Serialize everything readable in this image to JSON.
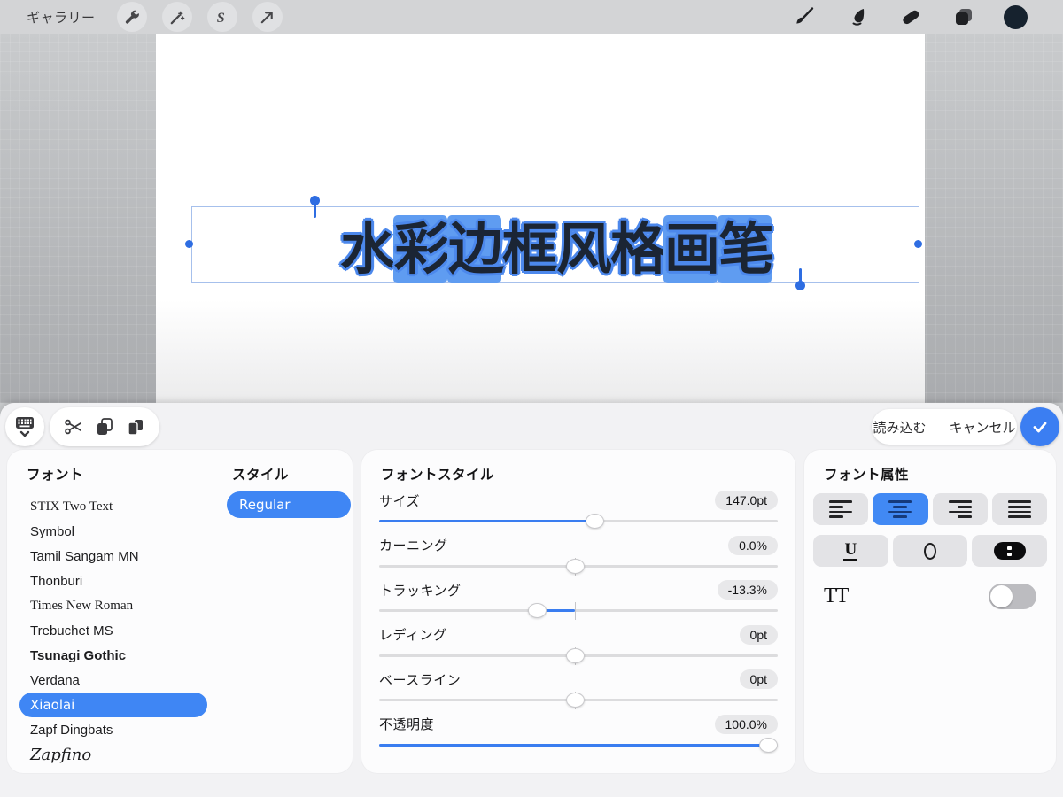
{
  "app": {
    "accent": "#3f86f4",
    "check_blue": "#3b7ef2",
    "swatch_color": "#16222e"
  },
  "topbar": {
    "gallery_label": "ギャラリー",
    "left_icons": [
      "wrench-icon",
      "adjustments-icon",
      "selection-icon",
      "transform-icon"
    ],
    "right_icons": [
      "brush-icon",
      "smudge-icon",
      "eraser-icon",
      "layers-icon",
      "color-swatch"
    ]
  },
  "canvas": {
    "text": "水彩边框风格画笔",
    "chars": [
      {
        "ch": "水",
        "highlight": false
      },
      {
        "ch": "彩",
        "highlight": true
      },
      {
        "ch": "边",
        "highlight": true
      },
      {
        "ch": "框",
        "highlight": false
      },
      {
        "ch": "风",
        "highlight": false
      },
      {
        "ch": "格",
        "highlight": false
      },
      {
        "ch": "画",
        "highlight": true
      },
      {
        "ch": "笔",
        "highlight": true
      }
    ],
    "selection": {
      "highlight_color": "#5f9cf1",
      "fill_color": "#1b2534",
      "outline_color": "#4c88ec"
    }
  },
  "sheet": {
    "toolbar": {
      "icons": [
        "keyboard-icon",
        "cut-icon",
        "copy-icon",
        "paste-icon"
      ],
      "import_label": "読み込む",
      "cancel_label": "キャンセル",
      "confirm_icon": "check-icon"
    },
    "font_panel": {
      "title": "フォント",
      "items": [
        {
          "label": "STIX Two Text",
          "style": "serif",
          "selected": false
        },
        {
          "label": "Symbol",
          "style": "sans",
          "selected": false
        },
        {
          "label": "Tamil Sangam MN",
          "style": "sans",
          "selected": false
        },
        {
          "label": "Thonburi",
          "style": "sans",
          "selected": false
        },
        {
          "label": "Times New Roman",
          "style": "serif",
          "selected": false
        },
        {
          "label": "Trebuchet MS",
          "style": "sans",
          "selected": false
        },
        {
          "label": "Tsunagi Gothic",
          "style": "bold",
          "selected": false
        },
        {
          "label": "Verdana",
          "style": "sans",
          "selected": false
        },
        {
          "label": "Xiaolai",
          "style": "hand",
          "selected": true
        },
        {
          "label": "Zapf Dingbats",
          "style": "sans",
          "selected": false
        },
        {
          "label": "Zapfino",
          "style": "script",
          "selected": false
        }
      ]
    },
    "style_panel": {
      "title": "スタイル",
      "selected_style": "Regular"
    },
    "fontstyle_panel": {
      "title": "フォントスタイル",
      "sliders": [
        {
          "label": "サイズ",
          "value": "147.0pt",
          "thumb_pct": 54,
          "fill_start_pct": 0,
          "fill_end_pct": 54,
          "center_tick": false
        },
        {
          "label": "カーニング",
          "value": "0.0%",
          "thumb_pct": 49,
          "fill_start_pct": 49,
          "fill_end_pct": 49,
          "center_tick": true
        },
        {
          "label": "トラッキング",
          "value": "-13.3%",
          "thumb_pct": 39.5,
          "fill_start_pct": 39.5,
          "fill_end_pct": 49,
          "center_tick": true
        },
        {
          "label": "レディング",
          "value": "0pt",
          "thumb_pct": 49,
          "fill_start_pct": 49,
          "fill_end_pct": 49,
          "center_tick": true
        },
        {
          "label": "ベースライン",
          "value": "0pt",
          "thumb_pct": 49,
          "fill_start_pct": 49,
          "fill_end_pct": 49,
          "center_tick": true
        },
        {
          "label": "不透明度",
          "value": "100.0%",
          "thumb_pct": 97.5,
          "fill_start_pct": 0,
          "fill_end_pct": 97.5,
          "center_tick": false
        }
      ]
    },
    "attributes_panel": {
      "title": "フォント属性",
      "alignments": [
        {
          "name": "align-left",
          "selected": false
        },
        {
          "name": "align-center",
          "selected": true
        },
        {
          "name": "align-right",
          "selected": false
        },
        {
          "name": "align-justify",
          "selected": false
        }
      ],
      "underline_label": "U",
      "tt_label": "TT",
      "tt_enabled": false
    }
  }
}
